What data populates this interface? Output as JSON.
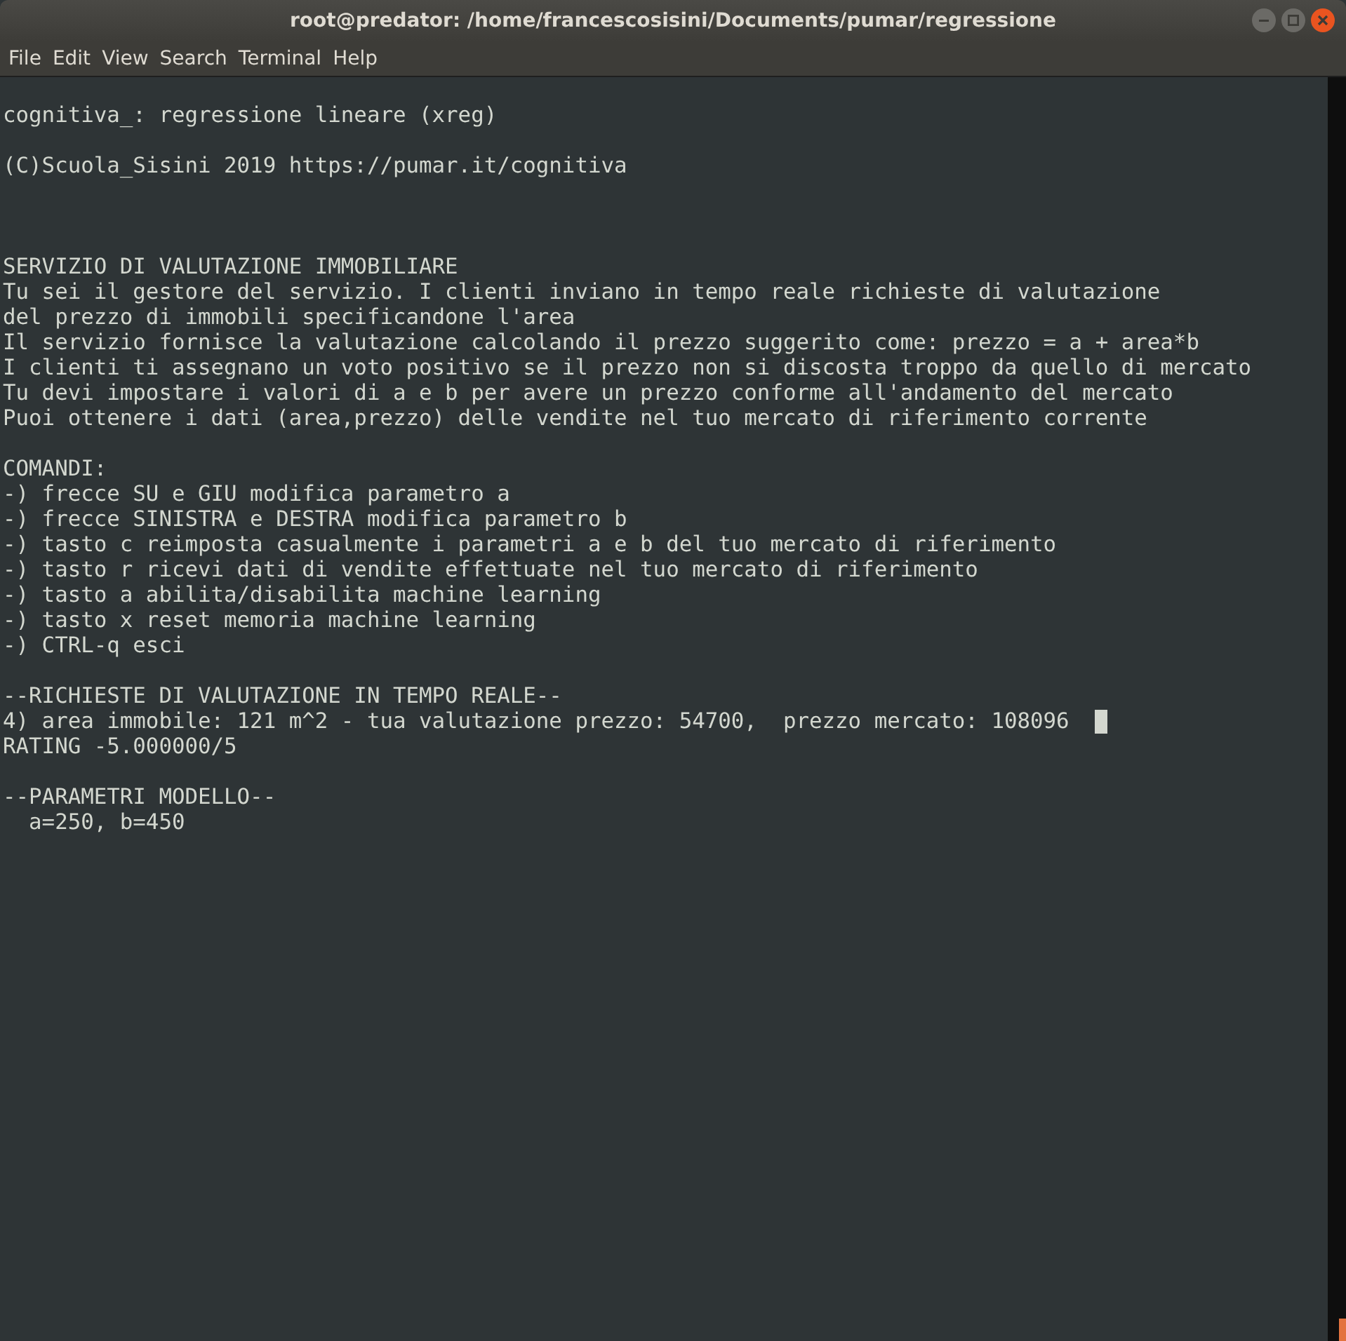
{
  "window": {
    "title": "root@predator: /home/francescosisini/Documents/pumar/regressione"
  },
  "menu": [
    "File",
    "Edit",
    "View",
    "Search",
    "Terminal",
    "Help"
  ],
  "terminal": {
    "lines": [
      {
        "kind": "blank"
      },
      {
        "kind": "text",
        "text": "cognitiva_: regressione lineare (xreg)"
      },
      {
        "kind": "blank"
      },
      {
        "kind": "text",
        "text": "(C)Scuola_Sisini 2019 https://pumar.it/cognitiva"
      },
      {
        "kind": "blank"
      },
      {
        "kind": "blank"
      },
      {
        "kind": "blank"
      },
      {
        "kind": "text",
        "text": "SERVIZIO DI VALUTAZIONE IMMOBILIARE"
      },
      {
        "kind": "text",
        "text": "Tu sei il gestore del servizio. I clienti inviano in tempo reale richieste di valutazione"
      },
      {
        "kind": "text",
        "text": "del prezzo di immobili specificandone l'area"
      },
      {
        "kind": "text",
        "text": "Il servizio fornisce la valutazione calcolando il prezzo suggerito come: prezzo = a + area*b"
      },
      {
        "kind": "text",
        "text": "I clienti ti assegnano un voto positivo se il prezzo non si discosta troppo da quello di mercato"
      },
      {
        "kind": "text",
        "text": "Tu devi impostare i valori di a e b per avere un prezzo conforme all'andamento del mercato"
      },
      {
        "kind": "text",
        "text": "Puoi ottenere i dati (area,prezzo) delle vendite nel tuo mercato di riferimento corrente"
      },
      {
        "kind": "blank"
      },
      {
        "kind": "text",
        "text": "COMANDI:"
      },
      {
        "kind": "text",
        "text": "-) frecce SU e GIU modifica parametro a"
      },
      {
        "kind": "text",
        "text": "-) frecce SINISTRA e DESTRA modifica parametro b"
      },
      {
        "kind": "text",
        "text": "-) tasto c reimposta casualmente i parametri a e b del tuo mercato di riferimento"
      },
      {
        "kind": "text",
        "text": "-) tasto r ricevi dati di vendite effettuate nel tuo mercato di riferimento"
      },
      {
        "kind": "text",
        "text": "-) tasto a abilita/disabilita machine learning"
      },
      {
        "kind": "text",
        "text": "-) tasto x reset memoria machine learning"
      },
      {
        "kind": "text",
        "text": "-) CTRL-q esci"
      },
      {
        "kind": "blank"
      },
      {
        "kind": "text",
        "text": "--RICHIESTE DI VALUTAZIONE IN TEMPO REALE--"
      },
      {
        "kind": "text",
        "text": "4) area immobile: 121 m^2 - tua valutazione prezzo: 54700,  prezzo mercato: 108096",
        "cursor": true
      },
      {
        "kind": "text",
        "text": "RATING -5.000000/5"
      },
      {
        "kind": "blank"
      },
      {
        "kind": "text",
        "text": "--PARAMETRI MODELLO--"
      },
      {
        "kind": "text",
        "text": "  a=250, b=450"
      }
    ]
  }
}
